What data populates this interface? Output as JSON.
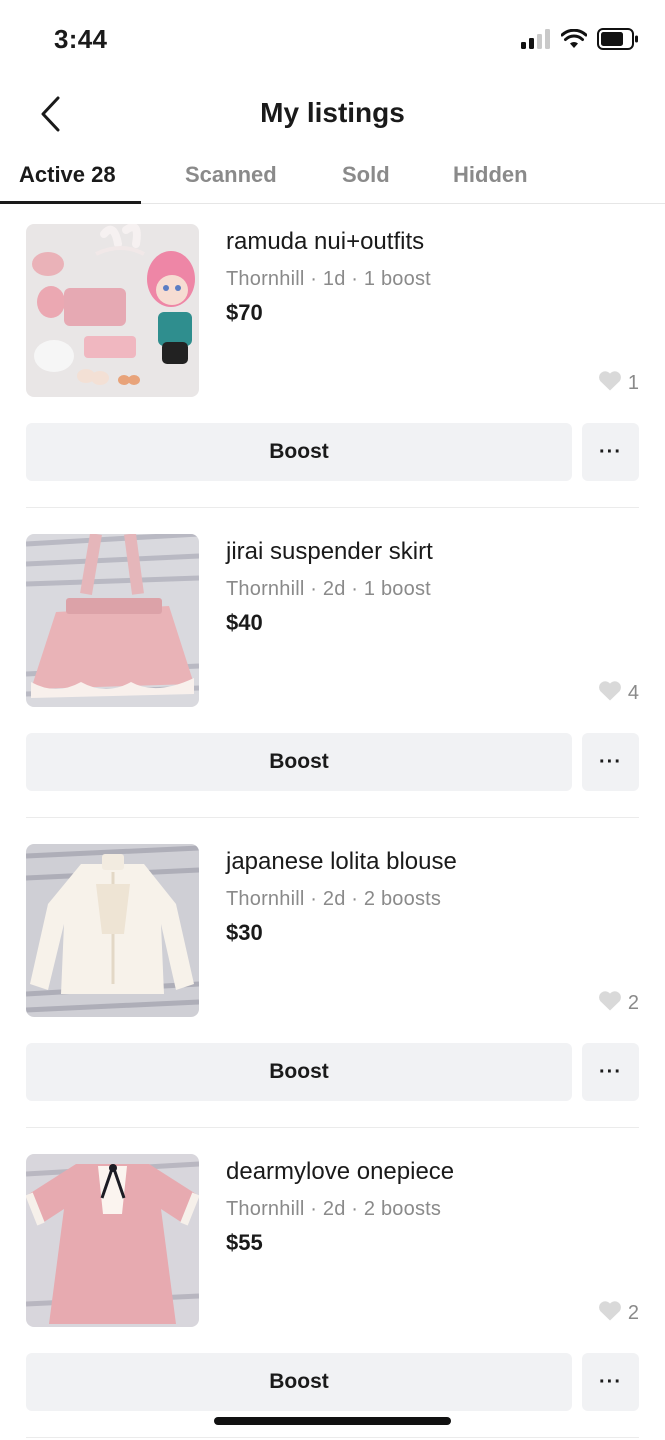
{
  "status_bar": {
    "time": "3:44",
    "icons": [
      "signal-icon",
      "wifi-icon",
      "battery-icon"
    ]
  },
  "nav": {
    "title": "My listings",
    "back_icon": "chevron-left-icon"
  },
  "tabs": [
    {
      "label": "Active 28",
      "active": true
    },
    {
      "label": "Scanned",
      "active": false
    },
    {
      "label": "Sold",
      "active": false
    },
    {
      "label": "Hidden",
      "active": false
    }
  ],
  "listings": [
    {
      "title": "ramuda nui+outfits",
      "meta": "Thornhill · 1d · 1 boost",
      "price": "$70",
      "likes": "1",
      "boost_label": "Boost",
      "more_label": "···"
    },
    {
      "title": "jirai suspender skirt",
      "meta": "Thornhill · 2d · 1 boost",
      "price": "$40",
      "likes": "4",
      "boost_label": "Boost",
      "more_label": "···"
    },
    {
      "title": "japanese lolita blouse",
      "meta": "Thornhill · 2d · 2 boosts",
      "price": "$30",
      "likes": "2",
      "boost_label": "Boost",
      "more_label": "···"
    },
    {
      "title": "dearmylove onepiece",
      "meta": "Thornhill · 2d · 2 boosts",
      "price": "$55",
      "likes": "2",
      "boost_label": "Boost",
      "more_label": "···"
    }
  ],
  "colors": {
    "text_primary": "#1a1a1a",
    "text_secondary": "#8a8a8a",
    "button_bg": "#f1f2f4",
    "divider": "#ebebeb",
    "heart": "#d9d9d9"
  }
}
